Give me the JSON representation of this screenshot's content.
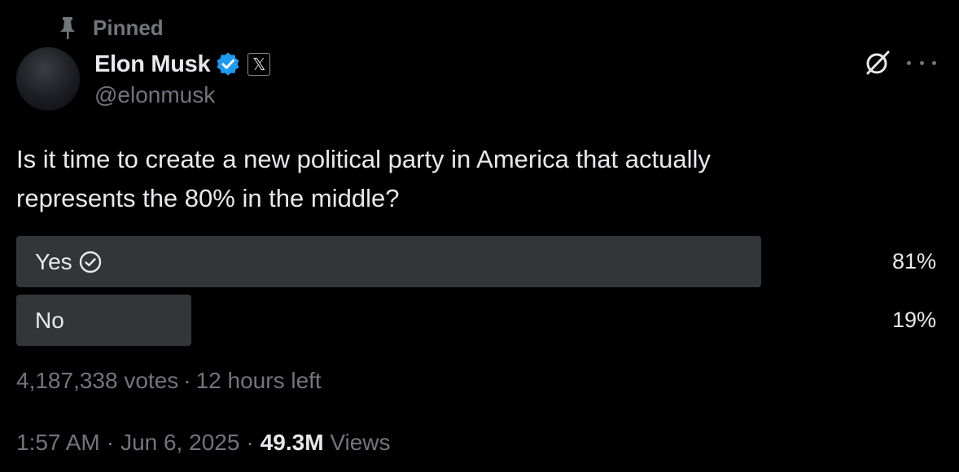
{
  "pinned": {
    "label": "Pinned"
  },
  "author": {
    "name": "Elon Musk",
    "handle": "@elonmusk",
    "affiliate_badge": "𝕏"
  },
  "post": {
    "text": "Is it time to create a new political party in America that actually represents the 80% in the middle?"
  },
  "poll": {
    "options": [
      {
        "label": "Yes",
        "percent_text": "81%",
        "percent": 81,
        "winner": true
      },
      {
        "label": "No",
        "percent_text": "19%",
        "percent": 19,
        "winner": false
      }
    ],
    "votes": "4,187,338 votes",
    "time_left": "12 hours left",
    "separator": "·"
  },
  "footer": {
    "time": "1:57 AM",
    "date": "Jun 6, 2025",
    "views_count": "49.3M",
    "views_label": "Views",
    "separator": "·"
  },
  "colors": {
    "background": "#000000",
    "text": "#e7e9ea",
    "muted": "#71767b",
    "bar": "#333639",
    "verified": "#1d9bf0"
  },
  "icons": [
    "pin-icon",
    "verified-badge-icon",
    "x-affiliate-icon",
    "grok-icon",
    "more-icon",
    "check-circle-icon"
  ]
}
